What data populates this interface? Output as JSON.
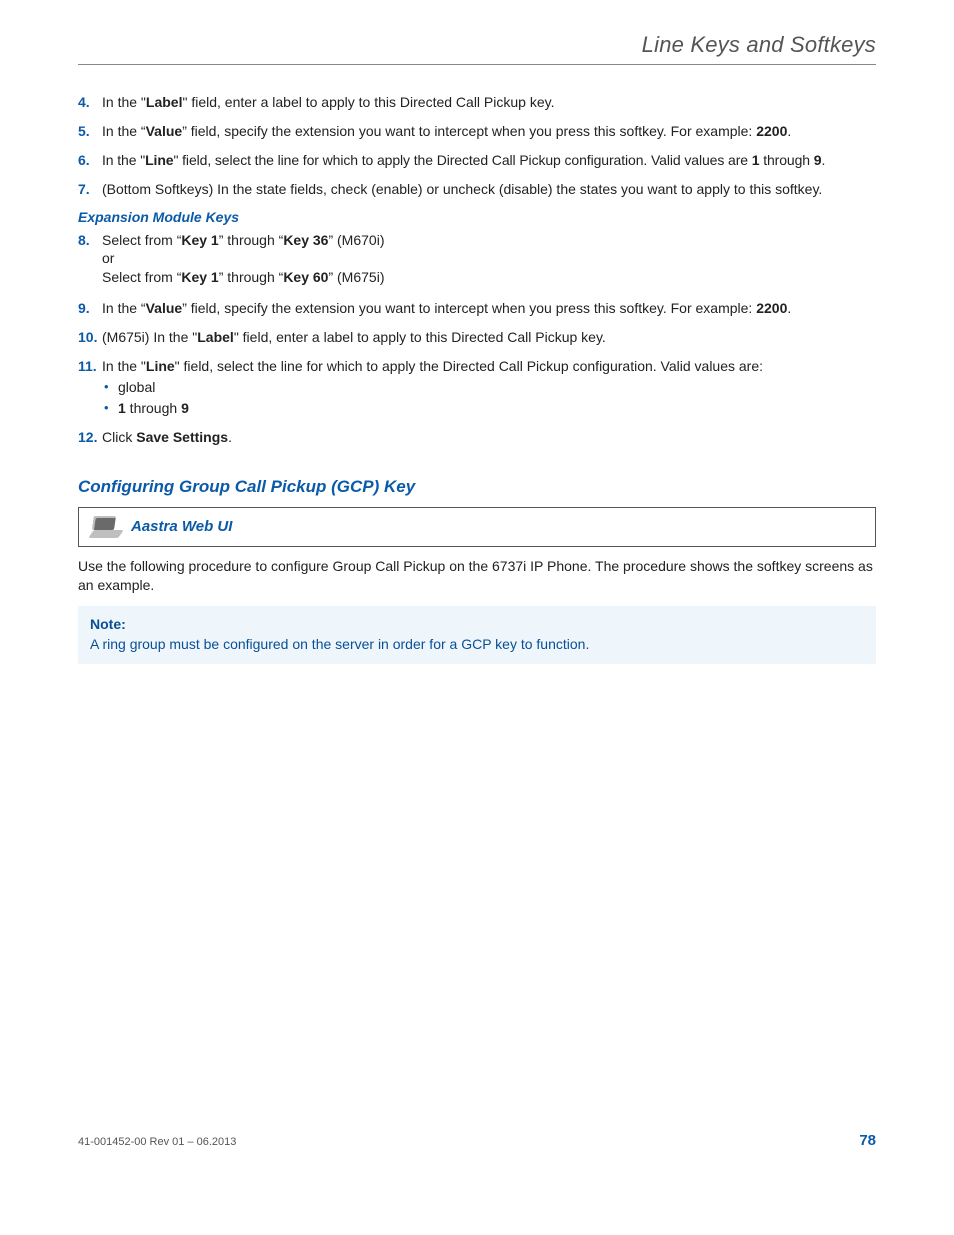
{
  "header": {
    "title": "Line Keys and Softkeys"
  },
  "steps": {
    "s4": {
      "num": "4.",
      "t1": "In the \"",
      "bLabel": "Label",
      "t2": "\" field, enter a label to apply to this Directed Call Pickup key."
    },
    "s5": {
      "num": "5.",
      "t1": "In the “",
      "bValue": "Value",
      "t2": "” field, specify the extension you want to intercept when you press this softkey. For example: ",
      "bEx": "2200",
      "t3": "."
    },
    "s6": {
      "num": "6.",
      "t1": "In the \"",
      "bLine": "Line",
      "t2": "\" field, select the line for which to apply the Directed Call Pickup configuration. Valid values are ",
      "b1": "1",
      "t3": " through ",
      "b9": "9",
      "t4": "."
    },
    "s7": {
      "num": "7.",
      "text": "(Bottom Softkeys) In the state fields, check (enable) or uncheck (disable) the states you want to apply to this softkey."
    },
    "s8": {
      "num": "8.",
      "l1a": "Select from “",
      "l1b": "Key 1",
      "l1c": "” through “",
      "l1d": "Key 36",
      "l1e": "” (M670i)",
      "or": "or",
      "l2a": "Select from “",
      "l2b": "Key 1",
      "l2c": "” through “",
      "l2d": "Key 60",
      "l2e": "” (M675i)"
    },
    "s9": {
      "num": "9.",
      "t1": "In the “",
      "bValue": "Value",
      "t2": "” field, specify the extension you want to intercept when you press this softkey. For example: ",
      "bEx": "2200",
      "t3": "."
    },
    "s10": {
      "num": "10.",
      "t1": "(M675i) In the \"",
      "bLabel": "Label",
      "t2": "\" field, enter a label to apply to this Directed Call Pickup key."
    },
    "s11": {
      "num": "11.",
      "t1": "In the \"",
      "bLine": "Line",
      "t2": "\" field, select the line for which to apply the Directed Call Pickup configuration. Valid values are:",
      "b1text": "global",
      "b2_1": "1",
      "b2_mid": " through ",
      "b2_9": "9"
    },
    "s12": {
      "num": "12.",
      "t1": "Click ",
      "bSave": "Save Settings",
      "t2": "."
    }
  },
  "subhead": {
    "expansion": "Expansion Module Keys"
  },
  "section": {
    "gcp": "Configuring Group Call Pickup (GCP) Key"
  },
  "uibox": {
    "label": "Aastra Web UI"
  },
  "paragraph": {
    "intro": "Use the following procedure to configure Group Call Pickup on the 6737i IP Phone. The procedure shows the softkey screens as an example."
  },
  "note": {
    "title": "Note:",
    "body": "A ring group must be configured on the server in order for a GCP key to function."
  },
  "footer": {
    "rev": "41-001452-00 Rev 01 – 06.2013",
    "page": "78"
  }
}
